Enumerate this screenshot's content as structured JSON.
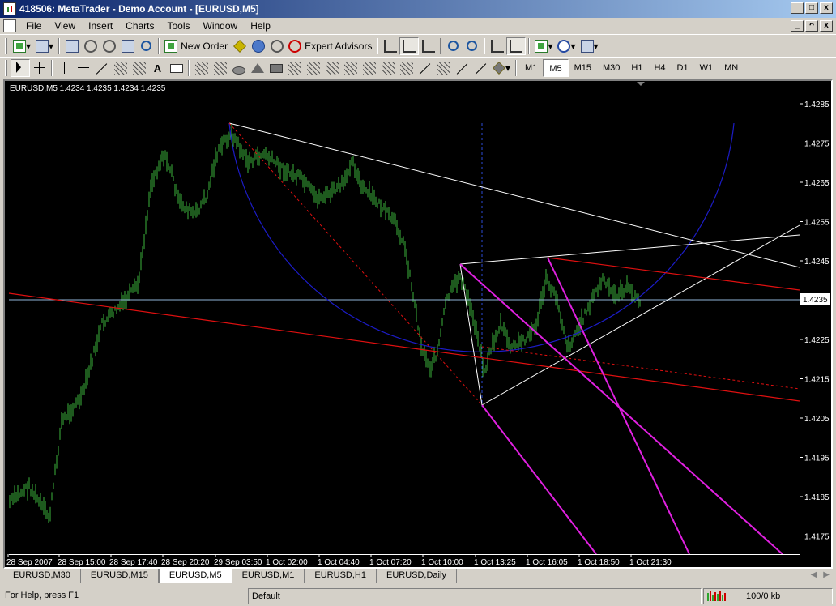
{
  "window": {
    "title": "418506: MetaTrader - Demo Account - [EURUSD,M5]",
    "controls": [
      "_",
      "□",
      "x"
    ],
    "mdi_controls": [
      "_",
      "ᴖ",
      "x"
    ]
  },
  "menu": {
    "items": [
      "File",
      "View",
      "Insert",
      "Charts",
      "Tools",
      "Window",
      "Help"
    ]
  },
  "toolbar1": {
    "new_order": "New Order",
    "expert_advisors": "Expert Advisors"
  },
  "toolbar2": {
    "text_tool": "A",
    "timeframes": [
      "M1",
      "M5",
      "M15",
      "M30",
      "H1",
      "H4",
      "D1",
      "W1",
      "MN"
    ],
    "active_timeframe": "M5"
  },
  "chart": {
    "header": "EURUSD,M5  1.4234 1.4235 1.4234 1.4235",
    "current_price": "1.4235",
    "price_labels": [
      "1.4285",
      "1.4275",
      "1.4265",
      "1.4255",
      "1.4245",
      "1.4235",
      "1.4225",
      "1.4215",
      "1.4205",
      "1.4195",
      "1.4185",
      "1.4175"
    ],
    "time_labels": [
      "28 Sep 2007",
      "28 Sep 15:00",
      "28 Sep 17:40",
      "28 Sep 20:20",
      "29 Sep 03:50",
      "1 Oct 02:00",
      "1 Oct 04:40",
      "1 Oct 07:20",
      "1 Oct 10:00",
      "1 Oct 13:25",
      "1 Oct 16:05",
      "1 Oct 18:50",
      "1 Oct 21:30"
    ],
    "colors": {
      "background": "#000000",
      "bars": "#3cb43c",
      "grid_text": "#ffffff",
      "price_line": "#8fb4d8",
      "circle": "#1c1cc8",
      "trendlines": "#ffffff",
      "red_lines": "#e01010",
      "channel": "#e020e0"
    }
  },
  "tabs": [
    "EURUSD,M30",
    "EURUSD,M15",
    "EURUSD,M5",
    "EURUSD,M1",
    "EURUSD,H1",
    "EURUSD,Daily"
  ],
  "active_tab": "EURUSD,M5",
  "status": {
    "help": "For Help, press F1",
    "profile": "Default",
    "traffic": "100/0 kb"
  }
}
